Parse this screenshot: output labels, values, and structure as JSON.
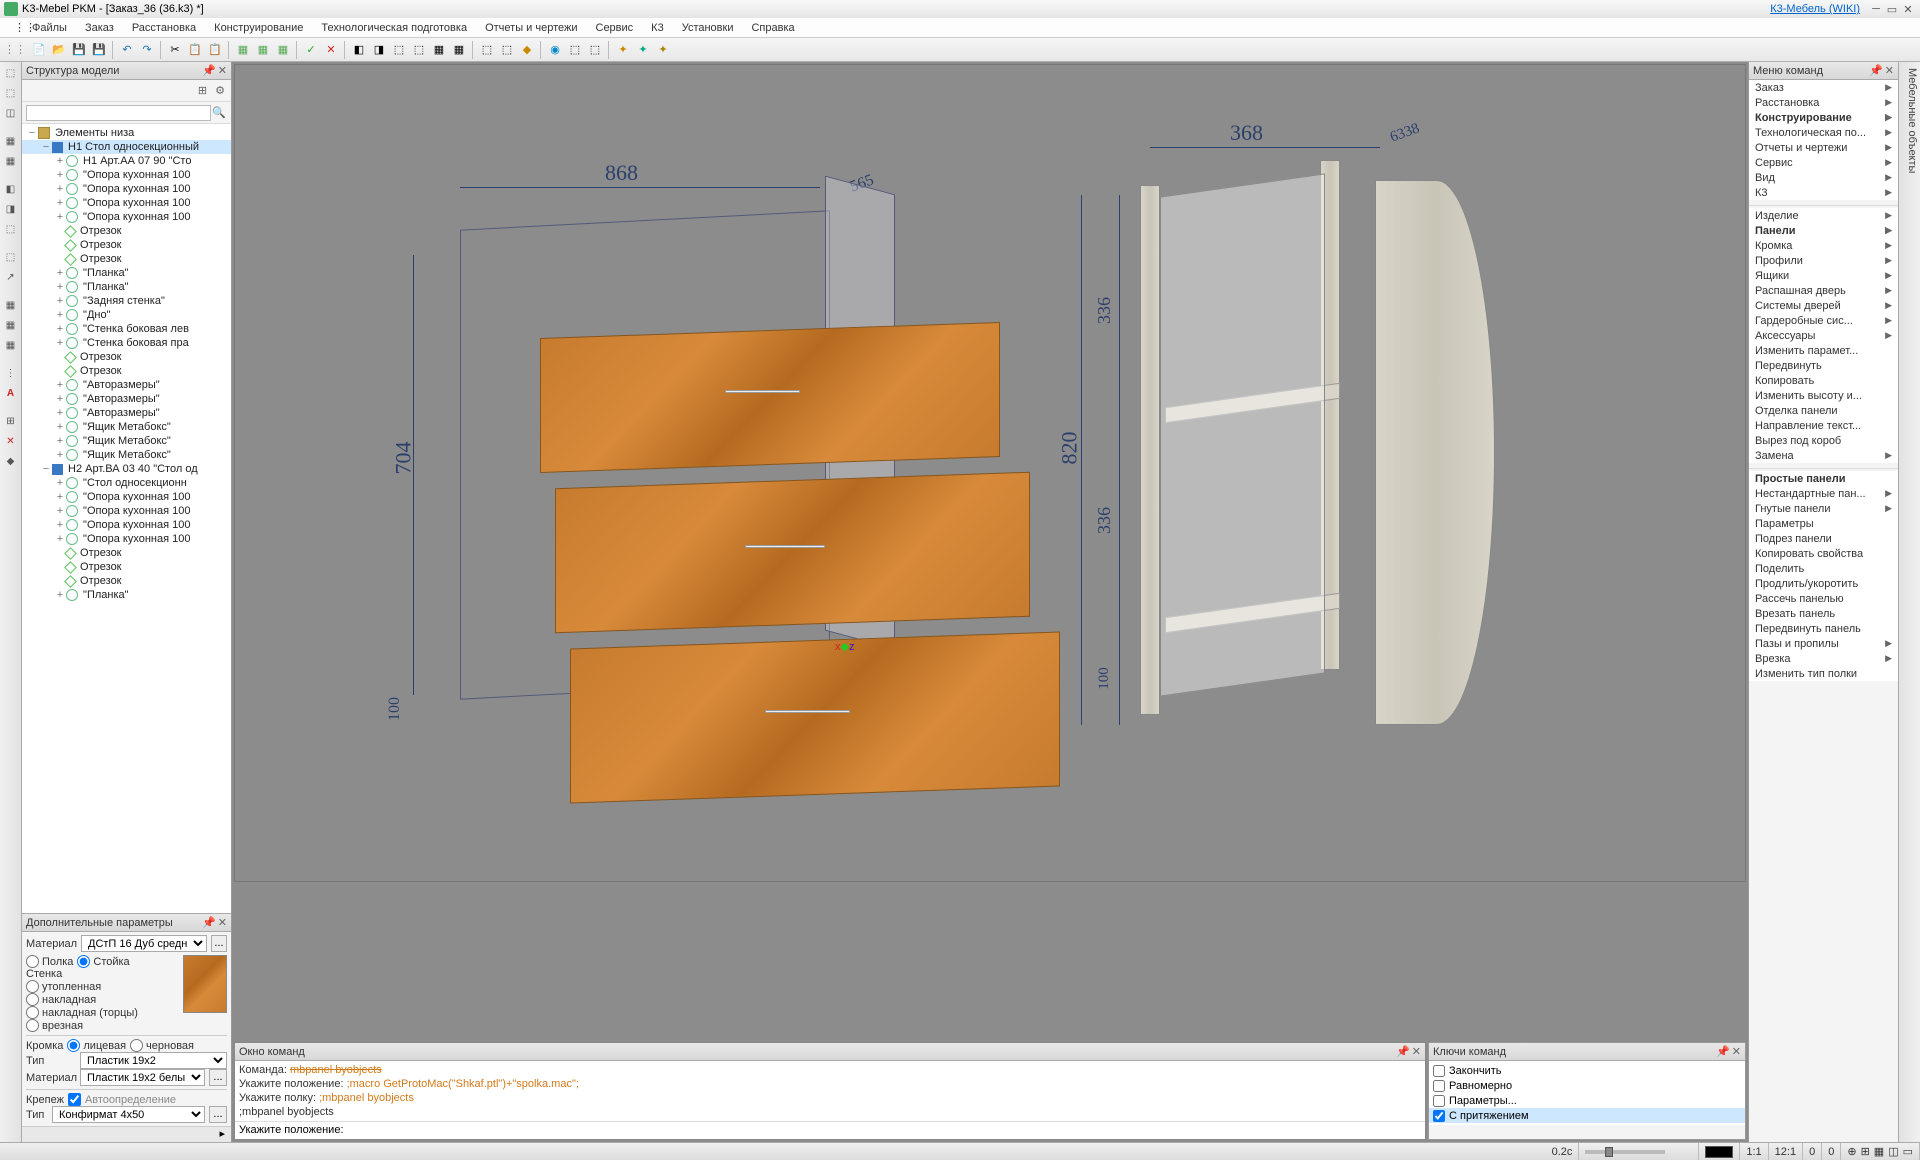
{
  "title": "K3-Mebel PKM - [Заказ_36 (36.k3) *]",
  "wiki_link": "К3-Мебель (WIKI)",
  "menu": [
    "Файлы",
    "Заказ",
    "Расстановка",
    "Конструирование",
    "Технологическая подготовка",
    "Отчеты и чертежи",
    "Сервис",
    "К3",
    "Установки",
    "Справка"
  ],
  "panels": {
    "structure": "Структура модели",
    "addparams": "Дополнительные параметры",
    "cmdwin": "Окно команд",
    "menucmd": "Меню команд",
    "keys": "Ключи команд",
    "righttab": "Мебельные объекты"
  },
  "tree": [
    {
      "d": 0,
      "t": "folder",
      "label": "Элементы низа",
      "tw": "−"
    },
    {
      "d": 1,
      "t": "grp",
      "label": "Н1 Стол односекционный",
      "tw": "−",
      "sel": true
    },
    {
      "d": 2,
      "t": "part",
      "label": "Н1 Арт.АА 07 90 \"Сто",
      "tw": "+"
    },
    {
      "d": 2,
      "t": "part",
      "label": "\"Опора кухонная 100",
      "tw": "+"
    },
    {
      "d": 2,
      "t": "part",
      "label": "\"Опора кухонная 100",
      "tw": "+"
    },
    {
      "d": 2,
      "t": "part",
      "label": "\"Опора кухонная 100",
      "tw": "+"
    },
    {
      "d": 2,
      "t": "part",
      "label": "\"Опора кухонная 100",
      "tw": "+"
    },
    {
      "d": 2,
      "t": "seg",
      "label": "Отрезок",
      "tw": ""
    },
    {
      "d": 2,
      "t": "seg",
      "label": "Отрезок",
      "tw": ""
    },
    {
      "d": 2,
      "t": "seg",
      "label": "Отрезок",
      "tw": ""
    },
    {
      "d": 2,
      "t": "part",
      "label": "\"Планка\"",
      "tw": "+"
    },
    {
      "d": 2,
      "t": "part",
      "label": "\"Планка\"",
      "tw": "+"
    },
    {
      "d": 2,
      "t": "part",
      "label": "\"Задняя стенка\"",
      "tw": "+"
    },
    {
      "d": 2,
      "t": "part",
      "label": "\"Дно\"",
      "tw": "+"
    },
    {
      "d": 2,
      "t": "part",
      "label": "\"Стенка боковая лев",
      "tw": "+"
    },
    {
      "d": 2,
      "t": "part",
      "label": "\"Стенка боковая пра",
      "tw": "+"
    },
    {
      "d": 2,
      "t": "seg",
      "label": "Отрезок",
      "tw": ""
    },
    {
      "d": 2,
      "t": "seg",
      "label": "Отрезок",
      "tw": ""
    },
    {
      "d": 2,
      "t": "part",
      "label": "\"Авторазмеры\"",
      "tw": "+"
    },
    {
      "d": 2,
      "t": "part",
      "label": "\"Авторазмеры\"",
      "tw": "+"
    },
    {
      "d": 2,
      "t": "part",
      "label": "\"Авторазмеры\"",
      "tw": "+"
    },
    {
      "d": 2,
      "t": "part",
      "label": "\"Ящик Метабокс\"",
      "tw": "+"
    },
    {
      "d": 2,
      "t": "part",
      "label": "\"Ящик Метабокс\"",
      "tw": "+"
    },
    {
      "d": 2,
      "t": "part",
      "label": "\"Ящик Метабокс\"",
      "tw": "+"
    },
    {
      "d": 1,
      "t": "grp",
      "label": "Н2 Арт.ВА 03 40 \"Стол од",
      "tw": "−"
    },
    {
      "d": 2,
      "t": "part",
      "label": "\"Стол односекционн",
      "tw": "+"
    },
    {
      "d": 2,
      "t": "part",
      "label": "\"Опора кухонная 100",
      "tw": "+"
    },
    {
      "d": 2,
      "t": "part",
      "label": "\"Опора кухонная 100",
      "tw": "+"
    },
    {
      "d": 2,
      "t": "part",
      "label": "\"Опора кухонная 100",
      "tw": "+"
    },
    {
      "d": 2,
      "t": "part",
      "label": "\"Опора кухонная 100",
      "tw": "+"
    },
    {
      "d": 2,
      "t": "seg",
      "label": "Отрезок",
      "tw": ""
    },
    {
      "d": 2,
      "t": "seg",
      "label": "Отрезок",
      "tw": ""
    },
    {
      "d": 2,
      "t": "seg",
      "label": "Отрезок",
      "tw": ""
    },
    {
      "d": 2,
      "t": "part",
      "label": "\"Планка\"",
      "tw": "+"
    }
  ],
  "ap": {
    "material_label": "Материал",
    "material_value": "ДСтП 16 Дуб средн",
    "polka": "Полка",
    "stoika": "Стойка",
    "stenka": "Стенка",
    "utoplennaya": "утопленная",
    "nakladnaya": "накладная",
    "nakladnaya_torcy": "накладная (торцы)",
    "vreznaya": "врезная",
    "kromka": "Кромка",
    "licevaya": "лицевая",
    "chernovaya": "черновая",
    "tip": "Тип",
    "tip_value": "Пластик 19х2",
    "material2_value": "Пластик 19х2 белы",
    "krepezh": "Крепеж",
    "autodetect": "Автоопределение",
    "tip2_value": "Конфирмат 4х50"
  },
  "cmd": {
    "l0a": "Команда: ",
    "l0b": "mbpanel byobjects",
    "l1a": "Укажите положение: ",
    "l1b": ";macro GetProtoMac(\"Shkaf.ptl\")+\"spolka.mac\";",
    "l2a": "Укажите полку: ",
    "l2b": ";mbpanel byobjects",
    "l3": ";mbpanel byobjects",
    "prompt": "Укажите положение: "
  },
  "rmenu1": [
    {
      "l": "Заказ",
      "a": true
    },
    {
      "l": "Расстановка",
      "a": true
    },
    {
      "l": "Конструирование",
      "a": true,
      "b": true
    },
    {
      "l": "Технологическая по...",
      "a": true
    },
    {
      "l": "Отчеты и чертежи",
      "a": true
    },
    {
      "l": "Сервис",
      "a": true
    },
    {
      "l": "Вид",
      "a": true
    },
    {
      "l": "К3",
      "a": true
    }
  ],
  "rmenu2": [
    {
      "l": "Изделие",
      "a": true
    },
    {
      "l": "Панели",
      "a": true,
      "b": true
    },
    {
      "l": "Кромка",
      "a": true
    },
    {
      "l": "Профили",
      "a": true
    },
    {
      "l": "Ящики",
      "a": true
    },
    {
      "l": "Распашная дверь",
      "a": true
    },
    {
      "l": "Системы дверей",
      "a": true
    },
    {
      "l": "Гардеробные сис...",
      "a": true
    },
    {
      "l": "Аксессуары",
      "a": true
    },
    {
      "l": "Изменить парамет...",
      "a": false
    },
    {
      "l": "Передвинуть",
      "a": false
    },
    {
      "l": "Копировать",
      "a": false
    },
    {
      "l": "Изменить высоту и...",
      "a": false
    },
    {
      "l": "Отделка панели",
      "a": false
    },
    {
      "l": "Направление текст...",
      "a": false
    },
    {
      "l": "Вырез под короб",
      "a": false
    },
    {
      "l": "Замена",
      "a": true
    }
  ],
  "rmenu3": [
    {
      "l": "Простые панели",
      "a": false,
      "b": true
    },
    {
      "l": "Нестандартные пан...",
      "a": true
    },
    {
      "l": "Гнутые панели",
      "a": true
    },
    {
      "l": "Параметры",
      "a": false
    },
    {
      "l": "Подрез панели",
      "a": false
    },
    {
      "l": "Копировать свойства",
      "a": false
    },
    {
      "l": "Поделить",
      "a": false
    },
    {
      "l": "Продлить/укоротить",
      "a": false
    },
    {
      "l": "Рассечь панелью",
      "a": false
    },
    {
      "l": "Врезать панель",
      "a": false
    },
    {
      "l": "Передвинуть панель",
      "a": false
    },
    {
      "l": "Пазы и пропилы",
      "a": true
    },
    {
      "l": "Врезка",
      "a": true
    },
    {
      "l": "Изменить тип полки",
      "a": false
    }
  ],
  "keys": [
    {
      "l": "Закончить",
      "c": false
    },
    {
      "l": "Равномерно",
      "c": false
    },
    {
      "l": "Параметры...",
      "c": false
    },
    {
      "l": "С притяжением",
      "c": true,
      "sel": true
    }
  ],
  "status": {
    "time": "0.2c",
    "s1": "1:1",
    "s2": "12:1",
    "s3": "0",
    "s4": "0"
  },
  "dims": {
    "d868": "868",
    "d565": "565",
    "d704": "704",
    "d100": "100",
    "d368": "368",
    "d6338": "6338",
    "d820": "820",
    "d336a": "336",
    "d336b": "336",
    "d100b": "100"
  }
}
